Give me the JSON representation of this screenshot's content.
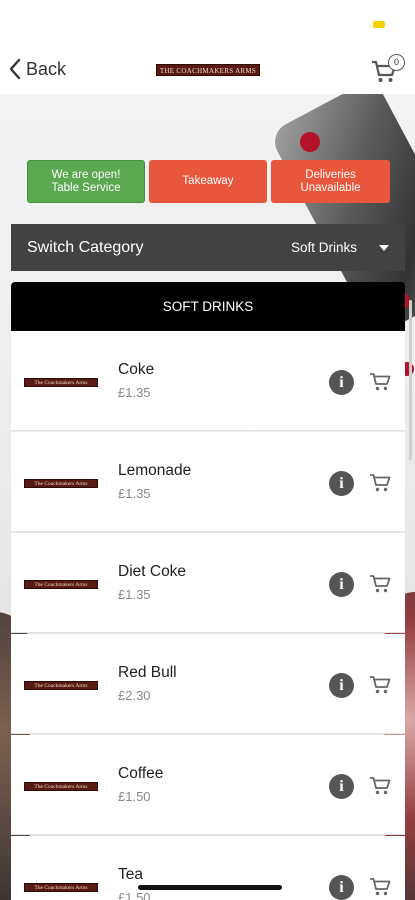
{
  "status_bar": {
    "indicator_color": "#f5d000"
  },
  "nav": {
    "back_label": "Back",
    "logo_text": "THE COACHMAKERS ARMS",
    "cart_count": "0"
  },
  "status_buttons": {
    "open_label": "We are open!\nTable Service",
    "takeaway_label": "Takeaway",
    "deliveries_label": "Deliveries\nUnavailable",
    "open_color": "#5aa84f",
    "accent_color": "#e8563b"
  },
  "category": {
    "label": "Switch Category",
    "selected": "Soft Drinks"
  },
  "list": {
    "header": "SOFT DRINKS",
    "items": [
      {
        "logo": "The Coachmakers Arms",
        "name": "Coke",
        "price": "£1.35"
      },
      {
        "logo": "The Coachmakers Arms",
        "name": "Lemonade",
        "price": "£1.35"
      },
      {
        "logo": "The Coachmakers Arms",
        "name": "Diet Coke",
        "price": "£1.35"
      },
      {
        "logo": "The Coachmakers Arms",
        "name": "Red Bull",
        "price": "£2.30"
      },
      {
        "logo": "The Coachmakers Arms",
        "name": "Coffee",
        "price": "£1.50"
      },
      {
        "logo": "The Coachmakers Arms",
        "name": "Tea",
        "price": "£1.50"
      }
    ]
  }
}
